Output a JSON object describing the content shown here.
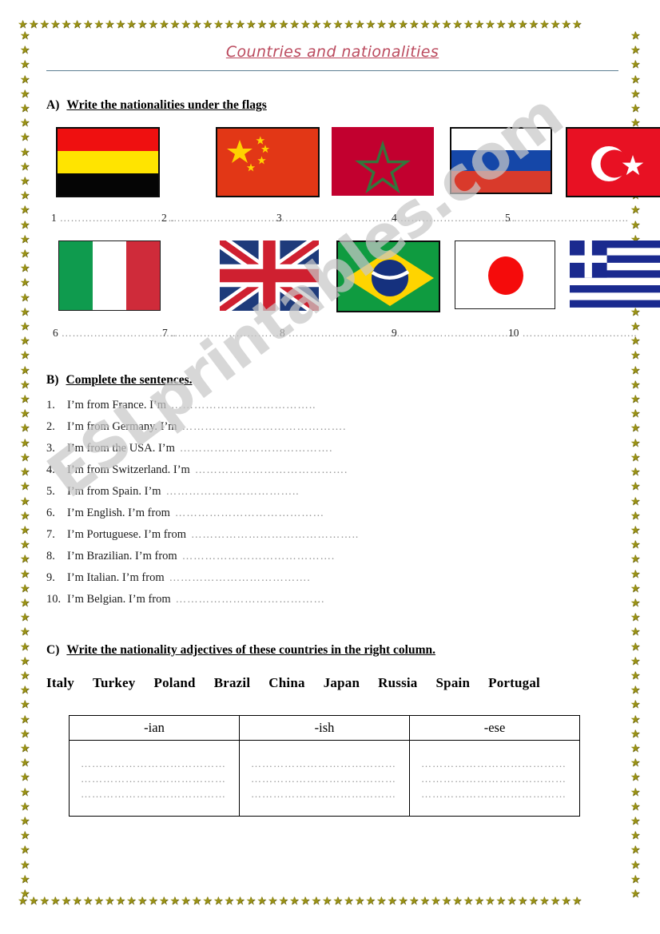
{
  "title": "Countries and nationalities",
  "watermark": "ESLprintables.com",
  "sections": {
    "a": {
      "letter": "A)",
      "heading": "Write the nationalities under the flags",
      "flags_row1": [
        {
          "num": "1",
          "country": "Belgium",
          "icon": "flag-belgium"
        },
        {
          "num": "2",
          "country": "China",
          "icon": "flag-china"
        },
        {
          "num": "3",
          "country": "Morocco",
          "icon": "flag-morocco"
        },
        {
          "num": "4",
          "country": "Russia",
          "icon": "flag-russia"
        },
        {
          "num": "5",
          "country": "Turkey",
          "icon": "flag-turkey"
        }
      ],
      "flags_row2": [
        {
          "num": "6",
          "country": "Italy",
          "icon": "flag-italy"
        },
        {
          "num": "7",
          "country": "United Kingdom",
          "icon": "flag-uk"
        },
        {
          "num": "8",
          "country": "Brazil",
          "icon": "flag-brazil"
        },
        {
          "num": "9",
          "country": "Japan",
          "icon": "flag-japan"
        },
        {
          "num": "10",
          "country": "Greece",
          "icon": "flag-greece"
        }
      ],
      "answer_dots": "………………………….."
    },
    "b": {
      "letter": "B)",
      "heading": "Complete the sentences.",
      "items": [
        {
          "num": "1.",
          "text": "I’m from France. I’m",
          "dots": "……………………………….."
        },
        {
          "num": "2.",
          "text": "I’m from Germany. I’m",
          "dots": "……………………………………."
        },
        {
          "num": "3.",
          "text": "I’m from the USA. I’m",
          "dots": "…………………………………."
        },
        {
          "num": "4.",
          "text": "I’m from Switzerland. I’m",
          "dots": "…………………………………."
        },
        {
          "num": "5.",
          "text": "I’m from Spain. I’m",
          "dots": "…………………………….."
        },
        {
          "num": "6.",
          "text": "I’m English. I’m from",
          "dots": "…………………………………"
        },
        {
          "num": "7.",
          "text": "I’m Portuguese. I’m from",
          "dots": "…………………………………….."
        },
        {
          "num": "8.",
          "text": "I’m Brazilian. I’m from",
          "dots": "…………………………………."
        },
        {
          "num": "9.",
          "text": "I’m Italian. I’m from",
          "dots": "………………………………."
        },
        {
          "num": "10.",
          "text": "I’m Belgian. I’m from",
          "dots": "…………………………………"
        }
      ]
    },
    "c": {
      "letter": "C)",
      "heading": "Write the nationality adjectives of these countries in the right column.",
      "word_bank": [
        "Italy",
        "Turkey",
        "Poland",
        "Brazil",
        "China",
        "Japan",
        "Russia",
        "Spain",
        "Portugal"
      ],
      "table": {
        "headers": [
          "-ian",
          "-ish",
          "-ese"
        ],
        "blank_line": "…………………………………",
        "lines_per_cell": 3
      }
    }
  },
  "colors": {
    "title": "#bb4a5e",
    "rule": "#5e7f93",
    "star": "#9a9216",
    "watermark": "#c8c8c8"
  }
}
